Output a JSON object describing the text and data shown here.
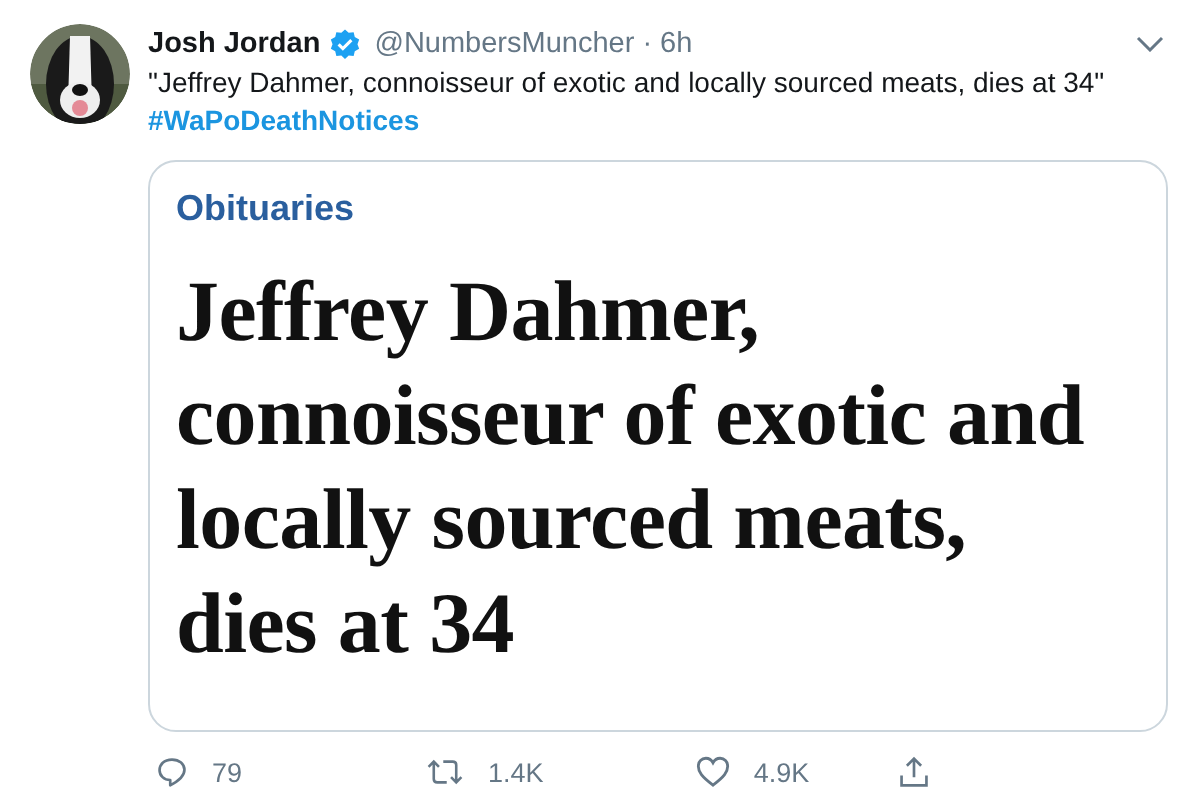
{
  "tweet": {
    "author": {
      "name": "Josh Jordan",
      "verified": true,
      "handle": "@NumbersMuncher",
      "separator": "·",
      "time": "6h"
    },
    "text": "\"Jeffrey Dahmer, connoisseur of exotic and locally sourced meats, dies at 34\"",
    "hashtag": "#WaPoDeathNotices",
    "card": {
      "section": "Obituaries",
      "headline": "Jeffrey Dahmer, connoisseur of exotic and locally sourced meats, dies at 34"
    },
    "actions": [
      {
        "kind": "reply",
        "count": "79"
      },
      {
        "kind": "retweet",
        "count": "1.4K"
      },
      {
        "kind": "like",
        "count": "4.9K"
      },
      {
        "kind": "share"
      }
    ]
  }
}
